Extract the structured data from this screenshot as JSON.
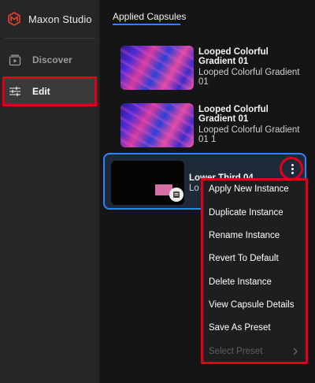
{
  "app": {
    "name": "Maxon Studio"
  },
  "sidebar": {
    "items": [
      {
        "label": "Discover",
        "icon": "play-stack-icon",
        "active": false
      },
      {
        "label": "Edit",
        "icon": "sliders-icon",
        "active": true
      }
    ]
  },
  "main": {
    "tabs": [
      {
        "label": "Applied Capsules",
        "active": true
      }
    ],
    "capsules": [
      {
        "title": "Looped Colorful Gradient 01",
        "subtitle": "Looped Colorful Gradient 01"
      },
      {
        "title": "Looped Colorful Gradient 01",
        "subtitle": "Looped Colorful Gradient 01 1"
      },
      {
        "title": "Lower Third 04",
        "subtitle": "Lo",
        "selected": true
      }
    ]
  },
  "context_menu": {
    "items": [
      {
        "label": "Apply New Instance",
        "enabled": true
      },
      {
        "label": "Duplicate Instance",
        "enabled": true
      },
      {
        "label": "Rename Instance",
        "enabled": true
      },
      {
        "label": "Revert To Default",
        "enabled": true
      },
      {
        "label": "Delete Instance",
        "enabled": true
      },
      {
        "label": "View Capsule Details",
        "enabled": true
      },
      {
        "label": "Save As Preset",
        "enabled": true
      },
      {
        "label": "Select Preset",
        "enabled": false,
        "has_submenu": true
      }
    ]
  },
  "colors": {
    "accent": "#2a84ff",
    "highlight": "#e0001b",
    "brand": "#e8402f"
  }
}
